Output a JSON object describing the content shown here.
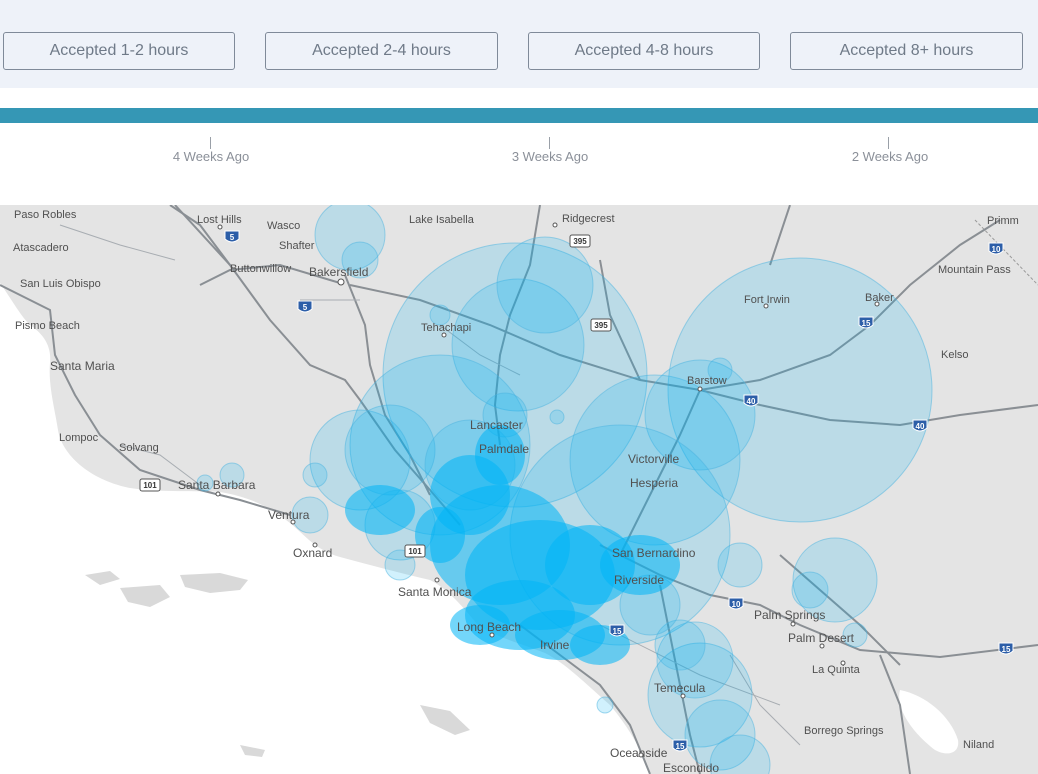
{
  "filters": [
    {
      "label": "Accepted 1-2 hours"
    },
    {
      "label": "Accepted 2-4 hours"
    },
    {
      "label": "Accepted 4-8 hours"
    },
    {
      "label": "Accepted 8+ hours"
    }
  ],
  "timeline": {
    "ticks": [
      {
        "label": "4 Weeks Ago"
      },
      {
        "label": "3 Weeks Ago"
      },
      {
        "label": "2 Weeks Ago"
      }
    ]
  },
  "map": {
    "places": [
      "Paso Robles",
      "Lost Hills",
      "Wasco",
      "Lake Isabella",
      "Ridgecrest",
      "Primm",
      "Atascadero",
      "Shafter",
      "Buttonwillow",
      "Bakersfield",
      "San Luis Obispo",
      "Mountain Pass",
      "Pismo Beach",
      "Tehachapi",
      "Fort Irwin",
      "Baker",
      "Santa Maria",
      "Kelso",
      "Barstow",
      "Lompoc",
      "Lancaster",
      "Solvang",
      "Palmdale",
      "Victorville",
      "Santa Barbara",
      "Hesperia",
      "Ventura",
      "Oxnard",
      "San Bernardino",
      "Santa Monica",
      "Riverside",
      "Long Beach",
      "Palm Springs",
      "Irvine",
      "Palm Desert",
      "La Quinta",
      "Temecula",
      "Borrego Springs",
      "Niland",
      "Oceanside",
      "Escondido"
    ],
    "highway_shields": [
      "5",
      "395",
      "5",
      "395",
      "15",
      "40",
      "40",
      "101",
      "101",
      "10",
      "15",
      "15",
      "10",
      "15"
    ],
    "colors": {
      "land": "#e4e4e4",
      "water": "#ffffff",
      "heat": "#00b4f5",
      "heat_outline": "#4cb3e0",
      "road": "#8a8f94"
    }
  }
}
